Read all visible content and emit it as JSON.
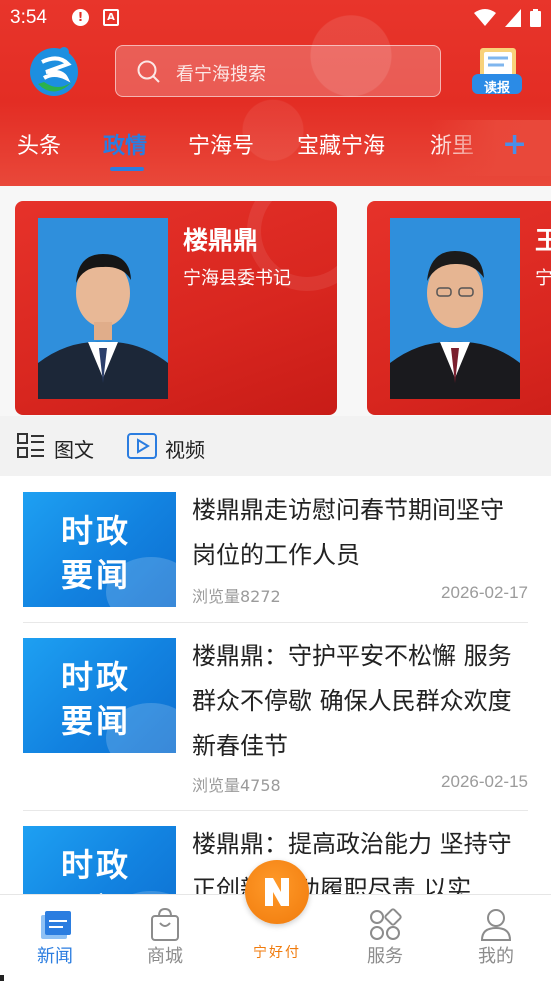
{
  "status_bar": {
    "time": "3:54",
    "notif1": "!",
    "notif2": "A"
  },
  "header": {
    "search_placeholder": "看宁海搜索",
    "dubao_label": "读报"
  },
  "tabs": [
    {
      "label": "头条",
      "active": false
    },
    {
      "label": "政情",
      "active": true
    },
    {
      "label": "宁海号",
      "active": false
    },
    {
      "label": "宝藏宁海",
      "active": false
    },
    {
      "label": "浙里",
      "active": false
    }
  ],
  "leaders": [
    {
      "name": "楼鼎鼎",
      "title": "宁海县委书记"
    },
    {
      "name": "王",
      "title": "宁 记"
    }
  ],
  "filters": [
    {
      "label": "图文",
      "icon": "list-grid-icon"
    },
    {
      "label": "视频",
      "icon": "video-play-icon"
    }
  ],
  "thumb_text": {
    "line1": "时政",
    "line2": "要闻"
  },
  "news": [
    {
      "title": "楼鼎鼎走访慰问春节期间坚守岗位的工作人员",
      "views": "浏览量8272",
      "date": "2026-02-17"
    },
    {
      "title": "楼鼎鼎：守护平安不松懈 服务群众不停歇 确保人民群众欢度新春佳节",
      "views": "浏览量4758",
      "date": "2026-02-15"
    },
    {
      "title": "楼鼎鼎：提高政治能力 坚持守正创新 主动履职尽责 以实",
      "views": "",
      "date": ""
    }
  ],
  "bottom_nav": [
    {
      "label": "新闻",
      "icon": "news-icon",
      "active": true
    },
    {
      "label": "商城",
      "icon": "shopping-bag-icon",
      "active": false
    },
    {
      "label": "宁好付",
      "icon": "ninghaofu-icon",
      "active": false
    },
    {
      "label": "服务",
      "icon": "services-icon",
      "active": false
    },
    {
      "label": "我的",
      "icon": "profile-icon",
      "active": false
    }
  ],
  "colors": {
    "header_red": "#e32d24",
    "accent_blue": "#2b7de0",
    "pay_orange": "#f07a0b"
  }
}
